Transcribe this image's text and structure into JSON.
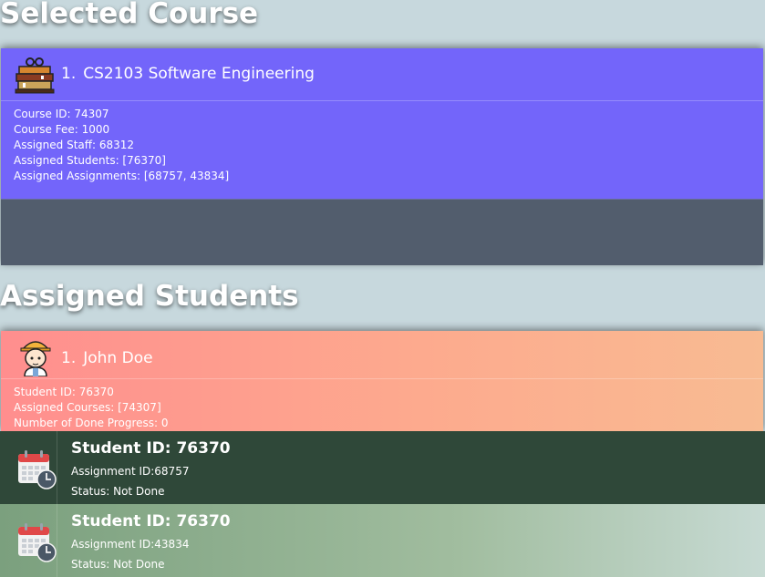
{
  "sections": {
    "selected_course_title": "Selected Course",
    "assigned_students_title": "Assigned Students"
  },
  "course": {
    "index": "1.",
    "name": "CS2103 Software Engineering",
    "icon": "books-stack-icon",
    "details": [
      "Course ID: 74307",
      "Course Fee: 1000",
      "Assigned Staff: 68312",
      "Assigned Students: [76370]",
      "Assigned Assignments: [68757, 43834]"
    ]
  },
  "student": {
    "index": "1.",
    "name": "John Doe",
    "icon": "student-avatar-icon",
    "details": [
      "Student ID: 76370",
      "Assigned Courses: [74307]",
      "Number of Done Progress: 0"
    ]
  },
  "assignments": [
    {
      "title": "Student ID: 76370",
      "assignment": "Assignment ID:68757",
      "status": "Status: Not Done",
      "icon": "calendar-clock-icon"
    },
    {
      "title": "Student ID: 76370",
      "assignment": "Assignment ID:43834",
      "status": "Status: Not Done",
      "icon": "calendar-clock-icon"
    }
  ],
  "colors": {
    "background": "#c7d8dd",
    "course_card": "#7365fa",
    "course_footer": "#525d6d",
    "student_card_start": "#ff8e8e",
    "student_card_end": "#f8bb92",
    "assignment_dark": "#2f4839",
    "assignment_light": "#7ba07e"
  }
}
